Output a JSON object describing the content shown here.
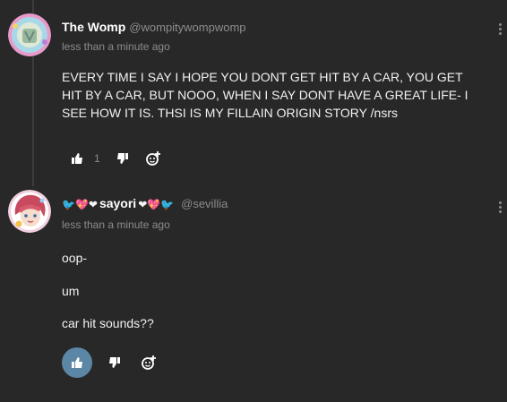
{
  "comments": [
    {
      "display_name": "The Womp",
      "handle": "@wompitywompwomp",
      "timestamp": "less than a minute ago",
      "body": "EVERY TIME I SAY I HOPE YOU DONT GET HIT BY A CAR, YOU GET HIT BY A CAR, BUT NOOO, WHEN I SAY DONT HAVE A GREAT LIFE- I SEE HOW IT IS. THSI IS MY FILLAIN ORIGIN STORY /nsrs",
      "like_count": "1"
    },
    {
      "name_prefix": "🐦💖❤",
      "display_name": "sayori",
      "name_suffix": "❤💖🐦",
      "handle": "@sevillia",
      "timestamp": "less than a minute ago",
      "paragraphs": [
        "oop-",
        "um",
        "car hit sounds??"
      ]
    }
  ],
  "colors": {
    "background": "#282828",
    "liked_button": "#5c86a6",
    "muted_text": "#8c8c8c"
  },
  "icons": {
    "like": "thumbs-up-icon",
    "dislike": "thumbs-down-icon",
    "react": "add-reaction-icon",
    "more": "kebab-menu-icon"
  }
}
